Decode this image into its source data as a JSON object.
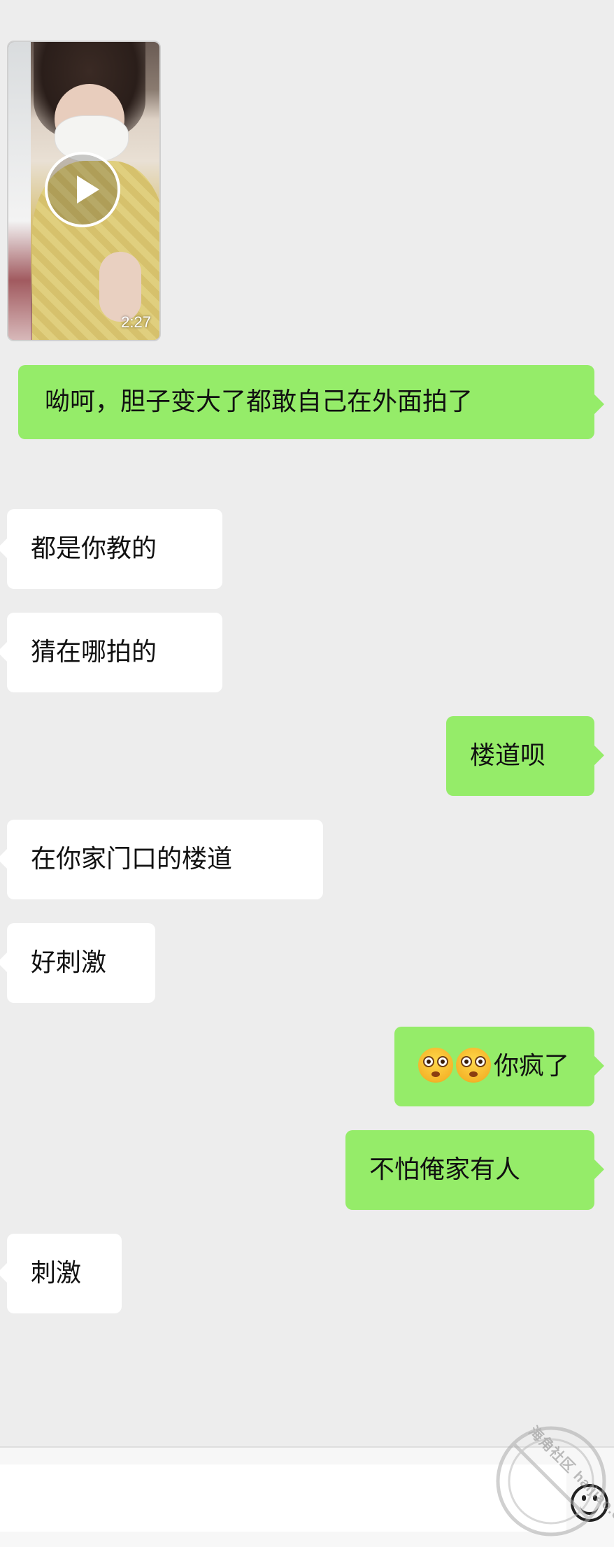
{
  "video": {
    "duration": "2:27"
  },
  "messages": [
    {
      "side": "right",
      "text": "呦呵，胆子变大了都敢自己在外面拍了"
    },
    {
      "side": "left",
      "text": "都是你教的"
    },
    {
      "side": "left",
      "text": "猜在哪拍的"
    },
    {
      "side": "right",
      "text": "楼道呗"
    },
    {
      "side": "left",
      "text": "在你家门口的楼道"
    },
    {
      "side": "left",
      "text": "好刺激"
    },
    {
      "side": "right",
      "text": "你疯了",
      "emoji_prefix": [
        "flushed-face-icon",
        "flushed-face-icon"
      ]
    },
    {
      "side": "right",
      "text": "不怕俺家有人"
    },
    {
      "side": "left",
      "text": "刺激"
    }
  ],
  "watermark": {
    "text": "海角社区 haijiao.com"
  },
  "colors": {
    "background": "#ededed",
    "sent_bubble": "#95ec69",
    "received_bubble": "#ffffff"
  }
}
